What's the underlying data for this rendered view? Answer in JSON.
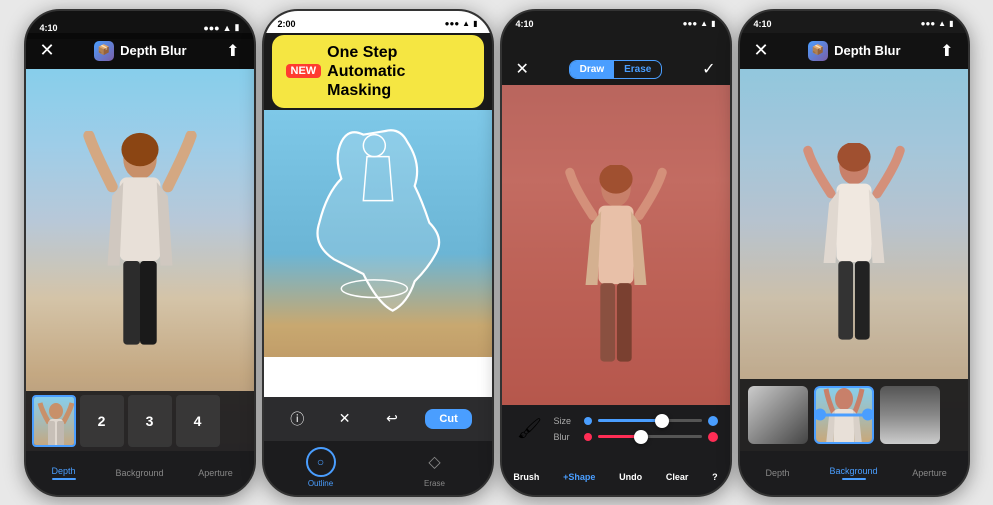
{
  "app": {
    "title": "Depth Blur",
    "phones": [
      {
        "id": "phone1",
        "statusBar": {
          "time": "4:10",
          "theme": "dark"
        },
        "nav": {
          "title": "Depth Blur",
          "hasBack": true,
          "hasShare": true
        },
        "tabs": [
          {
            "label": "Depth",
            "active": true
          },
          {
            "label": "Background",
            "active": false
          },
          {
            "label": "Aperture",
            "active": false
          }
        ],
        "thumbnails": [
          {
            "label": "",
            "selected": true
          },
          {
            "label": "2"
          },
          {
            "label": "3"
          },
          {
            "label": "4"
          }
        ]
      },
      {
        "id": "phone2",
        "statusBar": {
          "time": "2:00",
          "theme": "light"
        },
        "banner": {
          "newLabel": "NEW",
          "text": "One Step\nAutomatic Masking"
        },
        "toolbar": {
          "cutLabel": "Cut"
        },
        "bottomTools": [
          {
            "label": "Outline",
            "active": true,
            "icon": "○"
          },
          {
            "label": "Erase",
            "active": false,
            "icon": "◇"
          }
        ]
      },
      {
        "id": "phone3",
        "statusBar": {
          "time": "4:10",
          "theme": "dark"
        },
        "segControl": {
          "draw": "Draw",
          "erase": "Erase"
        },
        "sliders": [
          {
            "label": "Size",
            "dotColor": "#4a9eff",
            "trackColor": "#4a9eff",
            "value": 65
          },
          {
            "label": "Blur",
            "dotColor": "#ff2d55",
            "trackColor": "#ff2d55",
            "value": 45
          }
        ],
        "bottomTools": [
          {
            "label": "Brush",
            "icon": "🖌"
          },
          {
            "label": "+Shape"
          },
          {
            "label": "Undo"
          },
          {
            "label": "Clear"
          },
          {
            "label": "?",
            "icon": "?"
          }
        ]
      },
      {
        "id": "phone4",
        "statusBar": {
          "time": "4:10",
          "theme": "dark"
        },
        "nav": {
          "title": "Depth Blur",
          "hasBack": true,
          "hasShare": true
        },
        "tabs": [
          {
            "label": "Depth",
            "active": false
          },
          {
            "label": "Background",
            "active": true
          },
          {
            "label": "Aperture",
            "active": false
          }
        ],
        "thumbCards": [
          {
            "type": "depth",
            "label": "gradient-gray"
          },
          {
            "type": "bg-woman",
            "label": "woman-bg",
            "selected": true
          },
          {
            "type": "aperture",
            "label": "gradient-dark"
          }
        ]
      }
    ]
  }
}
